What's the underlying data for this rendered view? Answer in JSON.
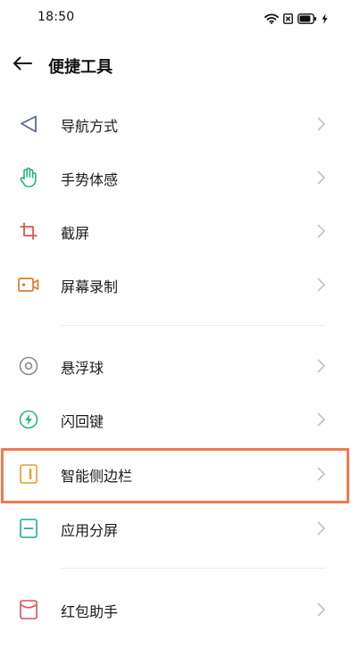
{
  "status": {
    "time": "18:50",
    "battery_level": 0.85
  },
  "header": {
    "title": "便捷工具"
  },
  "items": [
    {
      "label": "导航方式",
      "icon": "navigation-icon",
      "color": "#5b6b8c"
    },
    {
      "label": "手势体感",
      "icon": "hand-gesture-icon",
      "color": "#2db37a"
    },
    {
      "label": "截屏",
      "icon": "crop-icon",
      "color": "#e0584a"
    },
    {
      "label": "屏幕录制",
      "icon": "video-record-icon",
      "color": "#e07a2a"
    },
    {
      "label": "悬浮球",
      "icon": "floating-ball-icon",
      "color": "#8a8a8a"
    },
    {
      "label": "闪回键",
      "icon": "lightning-icon",
      "color": "#2db37a"
    },
    {
      "label": "智能侧边栏",
      "icon": "sidebar-icon",
      "color": "#e89a2a"
    },
    {
      "label": "应用分屏",
      "icon": "split-screen-icon",
      "color": "#1fa99a"
    },
    {
      "label": "红包助手",
      "icon": "red-envelope-icon",
      "color": "#e04a5a"
    }
  ],
  "highlight_color": "#ee7a52"
}
